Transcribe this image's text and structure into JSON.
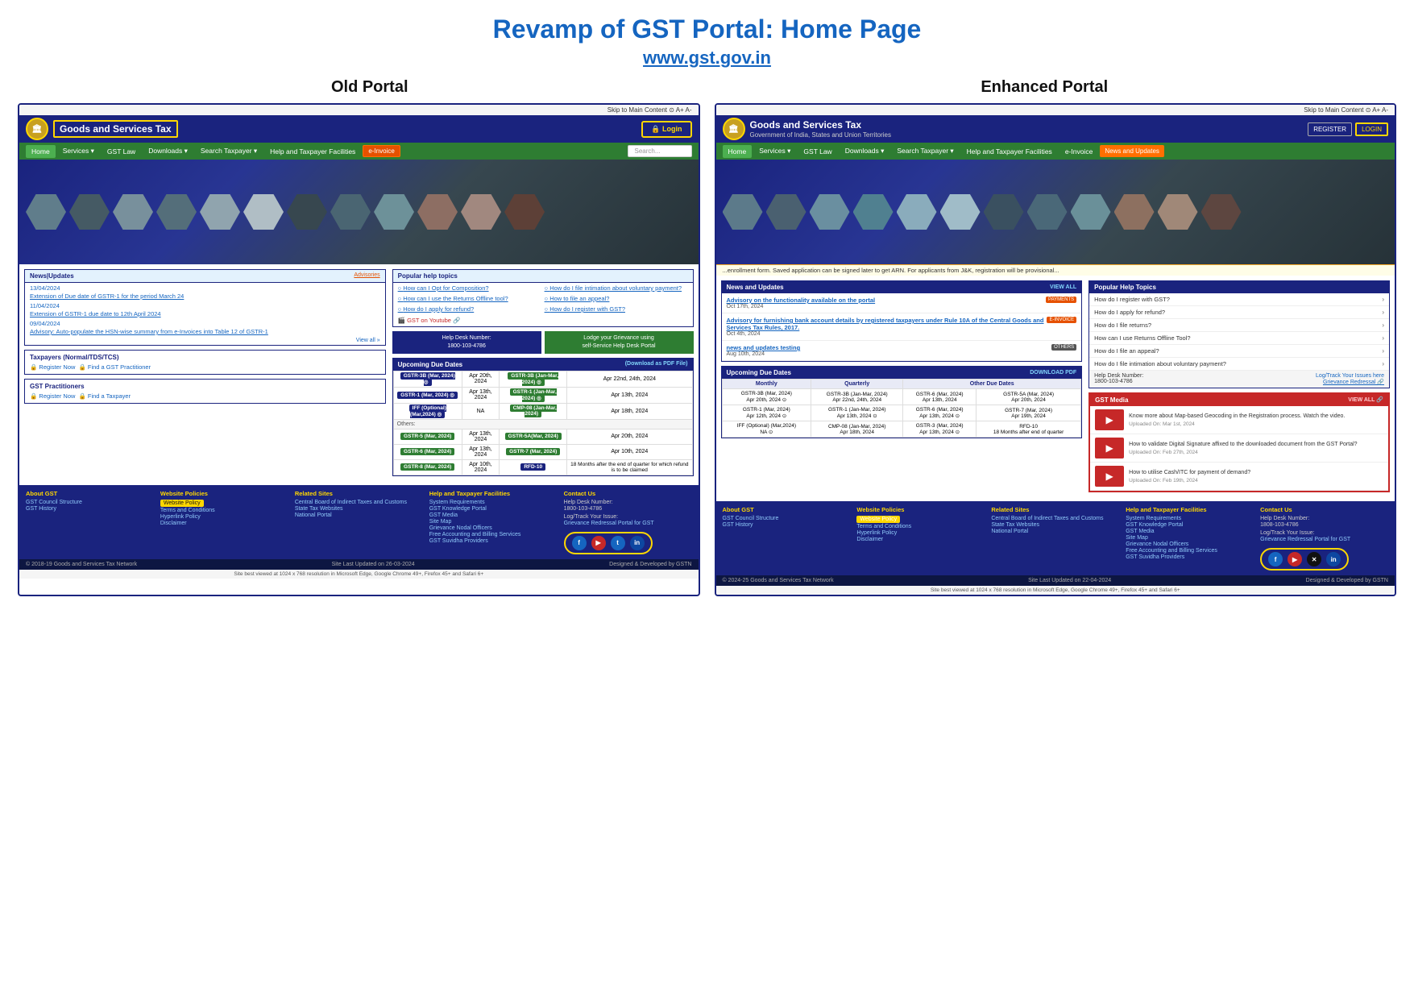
{
  "page": {
    "main_title_part1": "Revamp of GST Portal:",
    "main_title_part2": "Home Page",
    "subtitle_link": "www.gst.gov.in",
    "old_portal_label": "Old Portal",
    "enhanced_portal_label": "Enhanced Portal"
  },
  "old_portal": {
    "navbar_top": "Skip to Main Content  ⊙  A+  A-",
    "logo_text": "🏛",
    "nav_title": "Goods and Services Tax",
    "login_label": "🔒 Login",
    "menu_items": [
      "Home",
      "Services ▾",
      "GST Law",
      "Downloads ▾",
      "Search Taxpayer ▾",
      "Help and Taxpayer Facilities",
      "e-Invoice"
    ],
    "nav_search_placeholder": "Search...",
    "news_header": "News|Updates",
    "advisories_label": "Advisories",
    "news_items": [
      {
        "date": "13/04/2024",
        "text": "Extension of Due date of GSTR-1 for the period March 24"
      },
      {
        "date": "11/04/2024",
        "text": "Extension of GSTR-1 due date to 12th April 2024"
      },
      {
        "date": "09/04/2024",
        "text": "Advisory: Auto-populate the HSN-wise summary from e-Invoices into Table 12 of GSTR-1"
      }
    ],
    "view_all": "View all »",
    "popular_help_header": "Popular help topics",
    "help_items_col1": [
      "How can I Opt for Composition?",
      "How can I use the Returns Offline tool?",
      "How do I apply for refund?"
    ],
    "help_items_col2": [
      "How do I file intimation about voluntary payment?",
      "How to file an appeal?",
      "How do I register with GST?"
    ],
    "gst_youtube": "🎬 GST on Youtube 🔗",
    "helpdesk_label": "Help Desk Number:\n1800-103-4786",
    "grievance_label": "Lodge your Grievance using\nself-Service Help Desk Portal",
    "taxpayer_header": "Taxpayers (Normal/TDS/TCS)",
    "register_now": "🔒 Register Now",
    "find_practitioner": "🔒 Find a GST Practitioner",
    "gst_practitioners_header": "GST Practitioners",
    "register_now2": "🔒 Register Now",
    "find_taxpayer": "🔒 Find a Taxpayer",
    "due_dates_header": "Upcoming Due Dates",
    "download_pdf": "(Download as PDF File)",
    "due_dates": [
      {
        "col1": "GSTR-3B (Mar, 2024)",
        "col2": "Apr 20th, 2024",
        "col3": "GSTR-3B (Jan-Mar, 2024) ◎",
        "col4": "Apr 22nd, 24th, 2024"
      },
      {
        "col1": "GSTR-1 (Mar, 2024) ◎",
        "col2": "Apr 13th, 2024",
        "col3": "GSTR-1 (Jan-Mar, 2024) ◎",
        "col4": "Apr 13th, 2024"
      },
      {
        "col1": "IFF (Optional) (Mar,2024) ◎",
        "col2": "NA",
        "col3": "CMP-08 (Jan-Mar, 2024)",
        "col4": "Apr 18th, 2024"
      },
      {
        "col1": "GSTR-5 (Mar, 2024)",
        "col2": "Apr 13th, 2024",
        "col3": "GSTR-5A(Mar, 2024)",
        "col4": "Apr 20th, 2024"
      },
      {
        "col1": "GSTR-6 (Mar, 2024)",
        "col2": "Apr 13th, 2024",
        "col3": "GSTR-7 (Mar, 2024)",
        "col4": "Apr 10th, 2024"
      },
      {
        "col1": "GSTR-8 (Mar, 2024)",
        "col2": "Apr 10th, 2024",
        "col3": "RFD-10",
        "col4": "18 Months after the end of quarter for which refund is to be claimed"
      }
    ],
    "footer": {
      "about_gst_title": "About GST",
      "about_links": [
        "GST Council Structure",
        "GST History"
      ],
      "website_policies_title": "Website Policies",
      "website_policy_highlight": "Website Policy",
      "policy_links": [
        "Terms and Conditions",
        "Hyperlink Policy",
        "Disclaimer"
      ],
      "related_sites_title": "Related Sites",
      "related_links": [
        "Central Board of Indirect Taxes and Customs",
        "State Tax Websites",
        "National Portal"
      ],
      "help_title": "Help and Taxpayer Facilities",
      "help_links": [
        "System Requirements",
        "GST Knowledge Portal",
        "GST Media",
        "Site Map",
        "Grievance Nodal Officers",
        "Free Accounting and Billing Services",
        "GST Suvidha Providers"
      ],
      "contact_title": "Contact Us",
      "contact_lines": [
        "Help Desk Number:",
        "1800-103-4786",
        "",
        "Log/Track Your Issue:",
        "Grievance Redressal Portal for GST"
      ],
      "social_icons": [
        "f",
        "▶",
        "t",
        "in"
      ],
      "copyright": "© 2018-19 Goods and Services Tax Network",
      "last_updated": "Site Last Updated on 26-03-2024",
      "designed_by": "Designed & Developed by GSTN",
      "browser_info": "Site best viewed at 1024 x 768 resolution in Microsoft Edge, Google Chrome 49+, Firefox 45+ and Safari 6+"
    }
  },
  "enhanced_portal": {
    "navbar_top": "Skip to Main Content  ⊙  A+  A-",
    "logo_text": "🏛",
    "nav_title": "Goods and Services Tax",
    "nav_subtitle": "Government of India, States and Union Territories",
    "register_label": "REGISTER",
    "login_label": "LOGIN",
    "menu_items": [
      "Home",
      "Services ▾",
      "GST Law",
      "Downloads ▾",
      "Search Taxpayer ▾",
      "Help and Taxpayer Facilities",
      "e-Invoice",
      "News and Updates"
    ],
    "ticker": "...enrollment form. Saved application can be signed later to get ARN. For applicants from J&K, registration will be provisional...",
    "news_header": "News and Updates",
    "view_all": "VIEW ALL",
    "news_items": [
      {
        "title": "Advisory on the functionality available on the portal",
        "date": "Oct 17th, 2024",
        "badge": "PAYMENTS"
      },
      {
        "title": "Advisory for furnishing bank account details by registered taxpayers under Rule 10A of the Central Goods and Services Tax Rules, 2017.",
        "date": "Oct 4th, 2024",
        "badge": "E-INVOICE"
      },
      {
        "title": "news and updates testing",
        "date": "Aug 10th, 2024",
        "badge": "OTHERS"
      }
    ],
    "upcoming_due_header": "Upcoming Due Dates",
    "download_pdf": "DOWNLOAD PDF",
    "due_col_headers": [
      "Monthly",
      "Quarterly",
      "Other Due Dates"
    ],
    "due_rows": [
      {
        "monthly": "GSTR-3B (Mar, 2024)\nApr 20th, 2024 ⊙",
        "quarterly": "GSTR-3B (Jan-Mar, 2024)\nApr 22nd, 24th, 2024",
        "other": "GSTR-6 (Mar, 2024)\nApr 13th, 2024",
        "other2": "GSTR-5A (Mar, 2024)\nApr 20th, 2024"
      },
      {
        "monthly": "GSTR-1 (Mar, 2024)\nApr 12th, 2024 ⊙",
        "quarterly": "GSTR-1 (Jan-Mar, 2024)\nApr 13th, 2024 ⊙",
        "other": "GSTR-6 (Mar, 2024)\nApr 13th, 2024",
        "other2": "GSTR-7 (Mar, 2024)\nApr 19th, 2024"
      },
      {
        "monthly": "IFF (Optional) (Mar,2024)\nNA ⊙",
        "quarterly": "CMP-08 (Jan-Mar, 2024)\nApr 18th, 2024",
        "other": "GSTR-3 (Mar, 2024)\nApr 13th, 2024 ⊙",
        "other2": "RFD-10\n18 Months after the end of quarter for which refund is to be claimed"
      }
    ],
    "popular_help_header": "Popular Help Topics",
    "help_items": [
      "How do I register with GST?",
      "How do I apply for refund?",
      "How do I file returns?",
      "How can I use Returns Offline Tool?",
      "How do I file an appeal?",
      "How do I file intimation about voluntary payment?"
    ],
    "helpdesk_label": "Help Desk Number:\n1800-103-4786",
    "log_track": "Log/Track Your Issues here",
    "grievance": "Grievance Redressal 🔗",
    "gst_media_header": "GST Media",
    "view_all_media": "VIEW ALL 🔗",
    "media_items": [
      {
        "text": "Know more about Map-based Geocoding in the Registration process. Watch the video.",
        "date": "Uploaded On: Mar 1st, 2024"
      },
      {
        "text": "How to validate Digital Signature affixed to the downloaded document from the GST Portal?",
        "date": "Uploaded On: Feb 27th, 2024"
      },
      {
        "text": "How to utilise Cash/ITC for payment of demand?",
        "date": "Uploaded On: Feb 19th, 2024"
      }
    ],
    "footer": {
      "about_gst_title": "About GST",
      "about_links": [
        "GST Council Structure",
        "GST History"
      ],
      "website_policies_title": "Website Policies",
      "website_policy_highlight": "Website Policy",
      "policy_links": [
        "Terms and Conditions",
        "Hyperlink Policy",
        "Disclaimer"
      ],
      "related_sites_title": "Related Sites",
      "related_links": [
        "Central Board of Indirect Taxes and Customs",
        "State Tax Websites",
        "National Portal"
      ],
      "help_title": "Help and Taxpayer Facilities",
      "help_links": [
        "System Requirements",
        "GST Knowledge Portal",
        "GST Media",
        "Site Map",
        "Grievance Nodal Officers",
        "Free Accounting and Billing Services",
        "GST Suvidha Providers"
      ],
      "contact_title": "Contact Us",
      "contact_lines": [
        "Help Desk Number:",
        "1808-103-4786",
        "",
        "Log/Track Your Issue:",
        "Grievance Redressal Portal for GST"
      ],
      "social_icons": [
        "f",
        "▶",
        "✕",
        "in"
      ],
      "copyright": "© 2024-25 Goods and Services Tax Network",
      "last_updated": "Site Last Updated on 22-04-2024",
      "designed_by": "Designed & Developed by GSTN",
      "browser_info": "Site best viewed at 1024 x 768 resolution in Microsoft Edge, Google Chrome 49+, Firefox 45+ and Safari 6+"
    }
  }
}
